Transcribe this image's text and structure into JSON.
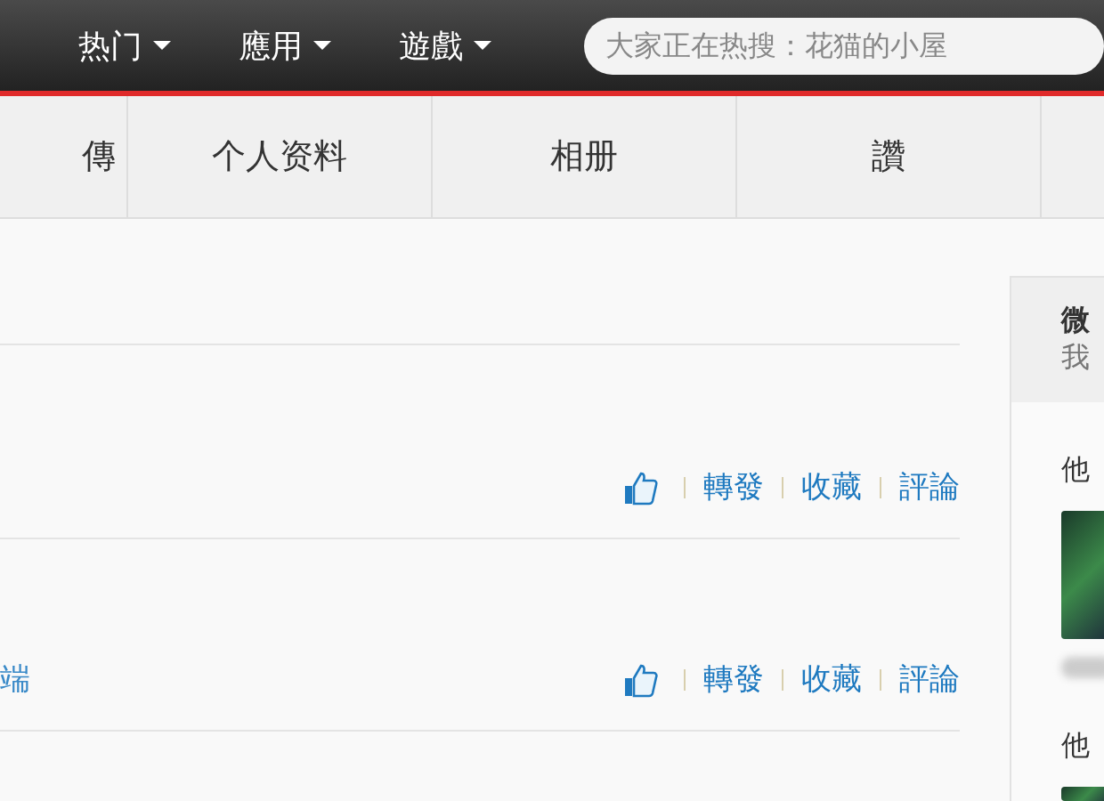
{
  "top_nav": {
    "menus": [
      {
        "label": "热门",
        "caret": true
      },
      {
        "label": "應用",
        "caret": true
      },
      {
        "label": "遊戲",
        "caret": true
      }
    ],
    "search": {
      "placeholder": "大家正在热搜：花猫的小屋"
    }
  },
  "tabs": [
    {
      "label": "傳",
      "selected": false
    },
    {
      "label": "个人资料",
      "selected": false
    },
    {
      "label": "相册",
      "selected": false
    },
    {
      "label": "讚",
      "selected": false
    },
    {
      "selected": false
    }
  ],
  "posts": [
    {
      "actions": [
        "轉發",
        "收藏",
        "評論"
      ]
    },
    {
      "source": "端",
      "actions": [
        "轉發",
        "收藏",
        "評論"
      ]
    }
  ],
  "sidebar": {
    "card": {
      "title": "微",
      "subtitle": "我"
    },
    "sections": [
      {
        "heading": "他"
      },
      {
        "heading": "他"
      }
    ]
  }
}
